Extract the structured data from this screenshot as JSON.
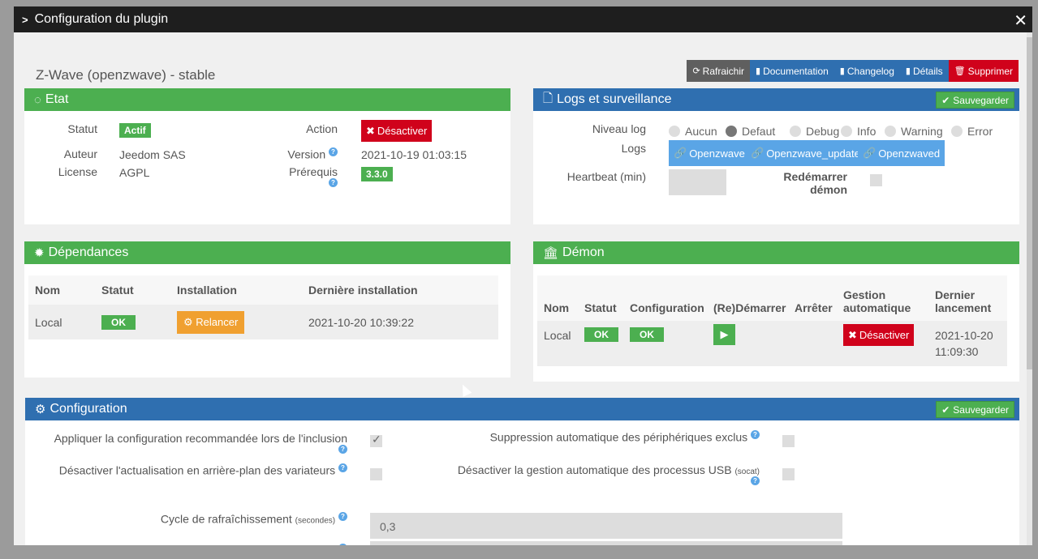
{
  "modal": {
    "title": "Configuration du plugin"
  },
  "plugin_name": "Z-Wave (openzwave) - stable",
  "toolbar": {
    "refresh": "Rafraichir",
    "documentation": "Documentation",
    "changelog": "Changelog",
    "details": "Détails",
    "delete": "Supprimer"
  },
  "etat": {
    "title": "Etat",
    "statut_label": "Statut",
    "statut_value": "Actif",
    "auteur_label": "Auteur",
    "auteur_value": "Jeedom SAS",
    "license_label": "License",
    "license_value": "AGPL",
    "action_label": "Action",
    "action_button": "Désactiver",
    "version_label": "Version",
    "version_value": "2021-10-19 01:03:15",
    "prerequis_label": "Prérequis",
    "prerequis_value": "3.3.0"
  },
  "logs": {
    "title": "Logs et surveillance",
    "save": "Sauvegarder",
    "niveau_label": "Niveau log",
    "levels": [
      "Aucun",
      "Defaut",
      "Debug",
      "Info",
      "Warning",
      "Error"
    ],
    "selected_level": "Defaut",
    "logs_label": "Logs",
    "files": [
      "Openzwave",
      "Openzwave_update",
      "Openzwaved"
    ],
    "heartbeat_label": "Heartbeat (min)",
    "restart_label": "Redémarrer démon"
  },
  "dependances": {
    "title": "Dépendances",
    "headers": [
      "Nom",
      "Statut",
      "Installation",
      "Dernière installation"
    ],
    "row": {
      "nom": "Local",
      "statut": "OK",
      "installation": "Relancer",
      "derniere": "2021-10-20 10:39:22"
    }
  },
  "demon": {
    "title": "Démon",
    "headers": [
      "Nom",
      "Statut",
      "Configuration",
      "(Re)Démarrer",
      "Arrêter",
      "Gestion automatique",
      "Dernier lancement"
    ],
    "row": {
      "nom": "Local",
      "statut": "OK",
      "configuration": "OK",
      "gestion": "Désactiver",
      "dernier": "2021-10-20 11:09:30"
    }
  },
  "configuration": {
    "title": "Configuration",
    "save": "Sauvegarder",
    "opt1": "Appliquer la configuration recommandée lors de l'inclusion",
    "opt2": "Désactiver l'actualisation en arrière-plan des variateurs",
    "opt3": "Suppression automatique des périphériques exclus",
    "opt4": "Désactiver la gestion automatique des processus USB",
    "opt4_sub": "(socat)",
    "cycle_label": "Cycle de rafraîchissement",
    "cycle_sub": "(secondes)",
    "cycle_value": "0,3"
  },
  "colors": {
    "green": "#4caf50",
    "blue": "#2f6fb0",
    "red": "#d0021b",
    "orange": "#f0a030",
    "light_blue": "#5aa5e6"
  }
}
